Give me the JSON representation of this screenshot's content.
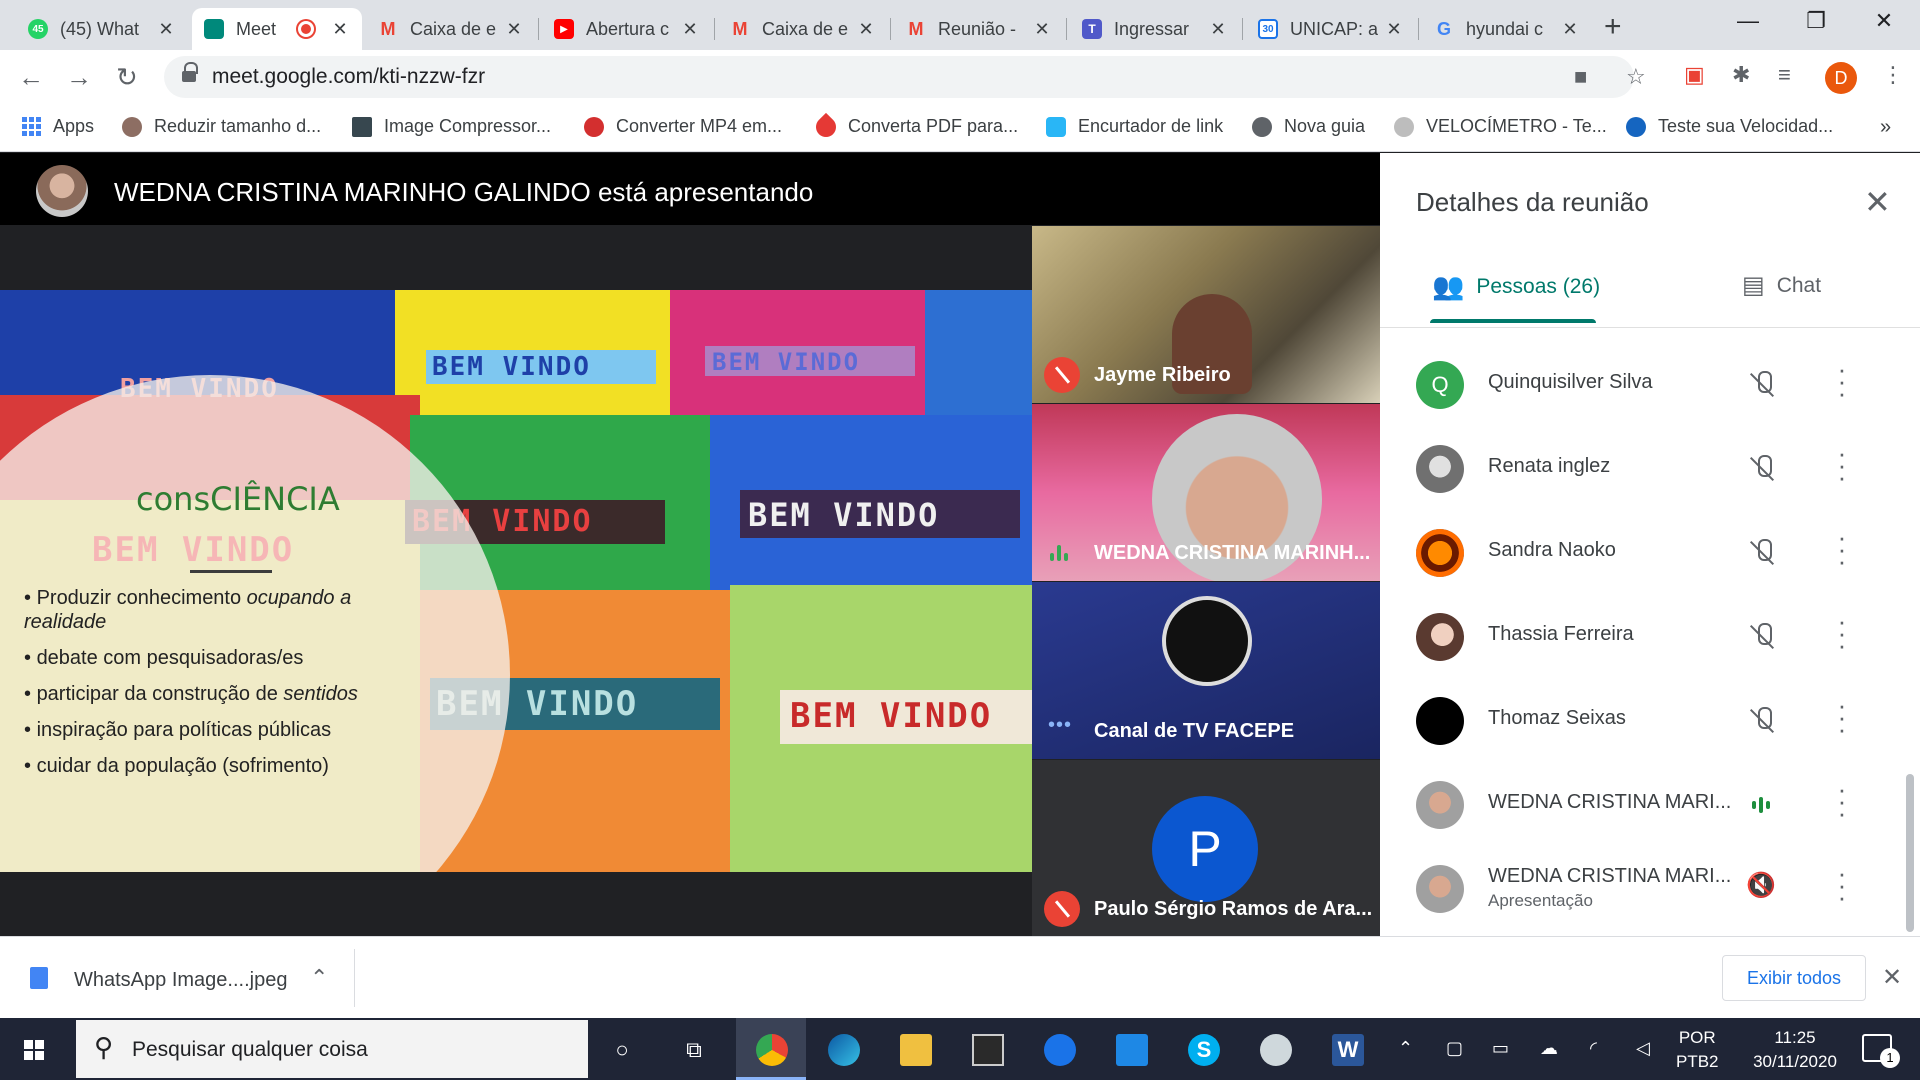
{
  "browser": {
    "tabs": [
      {
        "title": "(45) What",
        "favicon_color": "#25d366",
        "favicon_text": "45"
      },
      {
        "title": "Meet",
        "favicon_color": "#00897b",
        "favicon_text": "",
        "active": true
      },
      {
        "title": "Caixa de e",
        "favicon_color": "#ea4335",
        "favicon_text": "M"
      },
      {
        "title": "Abertura c",
        "favicon_color": "#ff0000",
        "favicon_text": "▶"
      },
      {
        "title": "Caixa de e",
        "favicon_color": "#ea4335",
        "favicon_text": "M"
      },
      {
        "title": "Reunião -",
        "favicon_color": "#ea4335",
        "favicon_text": "M"
      },
      {
        "title": "Ingressar",
        "favicon_color": "#5059c9",
        "favicon_text": "T"
      },
      {
        "title": "UNICAP: a",
        "favicon_color": "#1a73e8",
        "favicon_text": "30"
      },
      {
        "title": "hyundai c",
        "favicon_color": "#4285f4",
        "favicon_text": "G"
      }
    ],
    "url": "meet.google.com/kti-nzzw-fzr",
    "profile_letter": "D",
    "bookmarks": [
      {
        "label": "Apps"
      },
      {
        "label": "Reduzir tamanho d...",
        "color": "#8d6e63"
      },
      {
        "label": "Image Compressor...",
        "color": "#37474f"
      },
      {
        "label": "Converter MP4 em...",
        "color": "#d32f2f"
      },
      {
        "label": "Converta PDF para...",
        "color": "#e53935"
      },
      {
        "label": "Encurtador de link",
        "color": "#29b6f6"
      },
      {
        "label": "Nova guia",
        "color": "#5f6368"
      },
      {
        "label": "VELOCÍMETRO - Te...",
        "color": "#9e9e9e"
      },
      {
        "label": "Teste sua Velocidad...",
        "color": "#1565c0"
      }
    ],
    "more_bookmarks": "»"
  },
  "meeting": {
    "presenter_text": "WEDNA CRISTINA MARINHO GALINDO está apresentando",
    "slide": {
      "heading": "consCIÊNCIA",
      "rug_text": "BEM VINDO",
      "bullets": [
        {
          "text": "Produzir conhecimento ",
          "italic": "ocupando a realidade"
        },
        {
          "text": "debate com pesquisadoras/es",
          "italic": ""
        },
        {
          "text": "participar da construção de ",
          "italic": "sentidos"
        },
        {
          "text": "inspiração para políticas públicas",
          "italic": ""
        },
        {
          "text": "cuidar da população  (sofrimento)",
          "italic": ""
        }
      ]
    },
    "tiles": [
      {
        "name": "Jayme Ribeiro",
        "status": "muted"
      },
      {
        "name": "WEDNA CRISTINA MARINH...",
        "status": "speaking"
      },
      {
        "name": "Canal de TV FACEPE",
        "status": "dots"
      },
      {
        "name": "Paulo Sérgio Ramos de Ara...",
        "status": "muted",
        "avatar_letter": "P"
      }
    ]
  },
  "panel": {
    "title": "Detalhes da reunião",
    "tab_people": "Pessoas (26)",
    "tab_chat": "Chat",
    "people": [
      {
        "name": "Quinquisilver Silva",
        "avatar_letter": "Q",
        "avatar_color": "#34a853",
        "mic": "muted",
        "sub": ""
      },
      {
        "name": "Renata inglez",
        "avatar_letter": "",
        "avatar_color": "#9e9e9e",
        "mic": "muted",
        "sub": ""
      },
      {
        "name": "Sandra Naoko",
        "avatar_letter": "",
        "avatar_color": "#e65100",
        "mic": "muted",
        "sub": ""
      },
      {
        "name": "Thassia Ferreira",
        "avatar_letter": "",
        "avatar_color": "#a1887f",
        "mic": "muted",
        "sub": ""
      },
      {
        "name": "Thomaz Seixas",
        "avatar_letter": "",
        "avatar_color": "#000000",
        "mic": "muted",
        "sub": ""
      },
      {
        "name": "WEDNA CRISTINA MARI...",
        "avatar_letter": "",
        "avatar_color": "#8d6e63",
        "mic": "speaking",
        "sub": ""
      },
      {
        "name": "WEDNA CRISTINA MARI...",
        "avatar_letter": "",
        "avatar_color": "#8d6e63",
        "mic": "volume-off",
        "sub": "Apresentação"
      }
    ]
  },
  "downloads": {
    "file": "WhatsApp Image....jpeg",
    "show_all": "Exibir todos"
  },
  "taskbar": {
    "search_placeholder": "Pesquisar qualquer coisa",
    "lang_line1": "POR",
    "lang_line2": "PTB2",
    "time": "11:25",
    "date": "30/11/2020",
    "notifications": "1"
  }
}
